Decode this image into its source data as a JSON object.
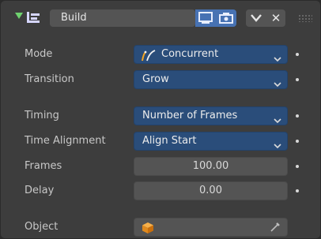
{
  "header": {
    "modifier_name": "Build",
    "collapse_icon": "triangle-down-icon",
    "modifier_icon": "build-modifier-icon",
    "viewport_icon": "monitor-icon",
    "render_icon": "camera-icon",
    "apply_icon": "chevron-down-icon",
    "close_label": "✕",
    "accent_color": "#4772b3",
    "arrow_color": "#6fd26f"
  },
  "properties": {
    "mode": {
      "label": "Mode",
      "value": "Concurrent",
      "icon": "grease-pencil-stroke-icon"
    },
    "transition": {
      "label": "Transition",
      "value": "Grow"
    },
    "timing": {
      "label": "Timing",
      "value": "Number of Frames"
    },
    "time_alignment": {
      "label": "Time Alignment",
      "value": "Align Start"
    },
    "frames": {
      "label": "Frames",
      "value": "100.00"
    },
    "delay": {
      "label": "Delay",
      "value": "0.00"
    },
    "object": {
      "label": "Object",
      "value": "",
      "icon": "cube-icon",
      "picker_icon": "eyedropper-icon"
    }
  },
  "colors": {
    "dropdown_bg": "#2a4d7a",
    "field_bg": "#545454",
    "panel_bg": "#3d3d3d"
  }
}
